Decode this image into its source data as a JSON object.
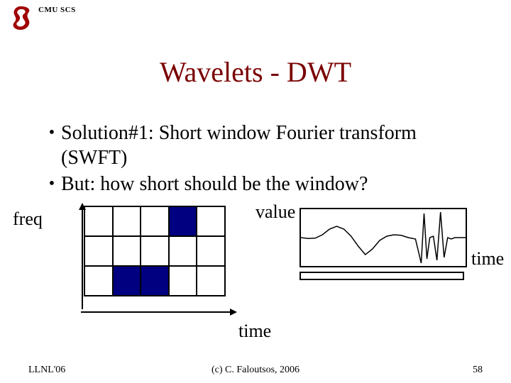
{
  "header": {
    "org_label": "CMU SCS"
  },
  "title": "Wavelets - DWT",
  "bullets": [
    "Solution#1: Short window Fourier transform (SWFT)",
    "But: how short should be the window?"
  ],
  "labels": {
    "freq": "freq",
    "value": "value",
    "time_grid": "time",
    "time_wave": "time"
  },
  "footer": {
    "left": "LLNL'06",
    "center": "(c) C. Faloutsos, 2006",
    "right": "58"
  },
  "chart_data": [
    {
      "type": "heatmap",
      "name": "time_freq_grid",
      "xlabel": "time",
      "ylabel": "freq",
      "rows": 3,
      "cols": 5,
      "cells": [
        [
          0,
          0,
          0,
          1,
          0
        ],
        [
          0,
          0,
          0,
          0,
          0
        ],
        [
          0,
          1,
          1,
          0,
          0
        ]
      ],
      "note": "1 = dark/navy filled cell, 0 = empty"
    },
    {
      "type": "line",
      "name": "time_series_wave",
      "xlabel": "time",
      "ylabel": "value",
      "x": [
        0,
        10,
        20,
        30,
        40,
        50,
        60,
        70,
        80,
        90,
        100,
        110,
        120,
        130,
        140,
        150,
        160,
        168,
        172,
        176,
        180,
        185,
        190,
        195,
        200,
        205,
        210,
        215,
        220,
        225,
        230
      ],
      "y": [
        0.0,
        -0.03,
        -0.02,
        0.1,
        0.3,
        0.4,
        0.3,
        0.05,
        -0.3,
        -0.6,
        -0.4,
        -0.1,
        0.05,
        0.1,
        0.08,
        0.0,
        -0.05,
        -0.9,
        0.85,
        -0.75,
        0.0,
        0.05,
        -0.8,
        0.9,
        -0.7,
        0.0,
        -0.05,
        0.0,
        0.0,
        0.0,
        0.0
      ],
      "ylim": [
        -1,
        1
      ],
      "xlim": [
        0,
        230
      ]
    }
  ]
}
